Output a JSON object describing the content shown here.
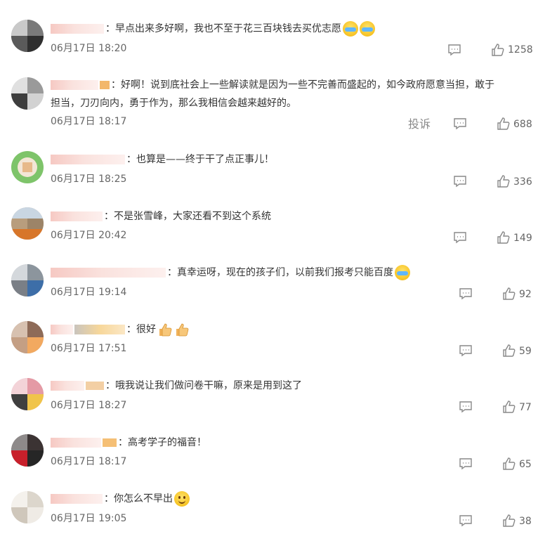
{
  "comments": [
    {
      "text": "：早点出来多好啊，我也不至于花三百块钱去买优志愿",
      "emojis": [
        "cry-laugh",
        "cry-laugh"
      ],
      "time": "06月17日 18:20",
      "likes": "1258"
    },
    {
      "text_line1": "：好啊！说到底社会上一些解读就是因为一些不完善而盛起的，如今政府愿意当担，敢于",
      "text_line2": "担当，刀刃向内，勇于作为，那么我相信会越来越好的。",
      "time": "06月17日 18:17",
      "report": "投诉",
      "likes": "688"
    },
    {
      "text": "：也算是——终于干了点正事儿！",
      "time": "06月17日 18:25",
      "likes": "336"
    },
    {
      "text": "：不是张雪峰，大家还看不到这个系统",
      "time": "06月17日 20:42",
      "likes": "149"
    },
    {
      "text": "：真幸运呀，现在的孩子们，以前我们报考只能百度",
      "emojis": [
        "cry-laugh"
      ],
      "time": "06月17日 19:14",
      "likes": "92"
    },
    {
      "text": "：很好",
      "emojis": [
        "thumbs-up",
        "thumbs-up"
      ],
      "time": "06月17日 17:51",
      "likes": "59"
    },
    {
      "text": "：哦我说让我们做问卷干嘛，原来是用到这了",
      "time": "06月17日 18:27",
      "likes": "77"
    },
    {
      "text": "：高考学子的福音！",
      "time": "06月17日 18:17",
      "likes": "65"
    },
    {
      "text": "：你怎么不早出",
      "emojis": [
        "smile"
      ],
      "time": "06月17日 19:05",
      "likes": "38"
    }
  ],
  "colors": {
    "text": "#333333",
    "meta": "#666666",
    "username_blur": "#f6c9c3"
  }
}
